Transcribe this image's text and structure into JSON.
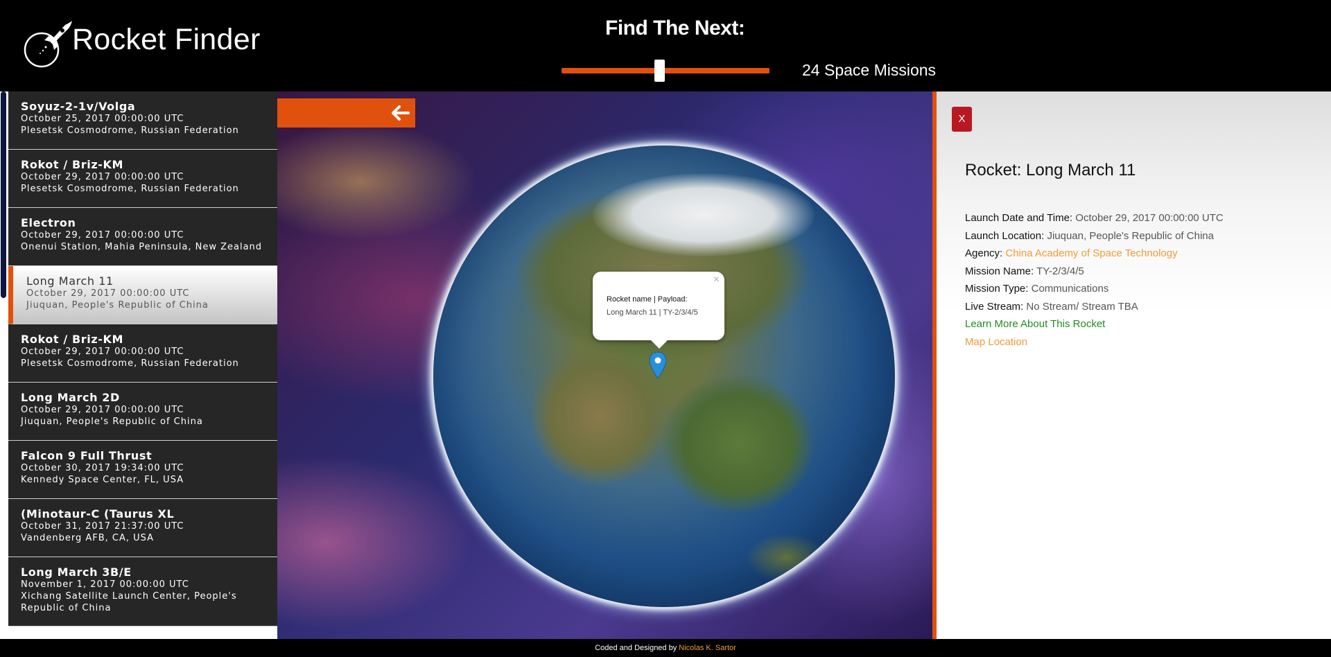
{
  "header": {
    "logo_text": "Rocket Finder",
    "find_title": "Find The Next:",
    "slider_fraction": 0.47,
    "missions_count": "24 Space Missions"
  },
  "launches": [
    {
      "name": "Soyuz-2-1v/Volga",
      "date": "October 25, 2017 00:00:00 UTC",
      "location": "Plesetsk Cosmodrome, Russian Federation"
    },
    {
      "name": "Rokot / Briz-KM",
      "date": "October 29, 2017 00:00:00 UTC",
      "location": "Plesetsk Cosmodrome, Russian Federation"
    },
    {
      "name": "Electron",
      "date": "October 29, 2017 00:00:00 UTC",
      "location": "Onenui Station, Mahia Peninsula, New Zealand"
    },
    {
      "name": "Long March 11",
      "date": "October 29, 2017 00:00:00 UTC",
      "location": "Jiuquan, People's Republic of China"
    },
    {
      "name": "Rokot / Briz-KM",
      "date": "October 29, 2017 00:00:00 UTC",
      "location": "Plesetsk Cosmodrome, Russian Federation"
    },
    {
      "name": "Long March 2D",
      "date": "October 29, 2017 00:00:00 UTC",
      "location": "Jiuquan, People's Republic of China"
    },
    {
      "name": "Falcon 9 Full Thrust",
      "date": "October 30, 2017 19:34:00 UTC",
      "location": "Kennedy Space Center, FL, USA"
    },
    {
      "name": "(Minotaur-C (Taurus XL",
      "date": "October 31, 2017 21:37:00 UTC",
      "location": "Vandenberg AFB, CA, USA"
    },
    {
      "name": "Long March 3B/E",
      "date": "November 1, 2017 00:00:00 UTC",
      "location": "Xichang Satellite Launch Center, People's Republic of China"
    }
  ],
  "map": {
    "popup_label": "Rocket name | Payload:",
    "popup_value": "Long March 11 | TY-2/3/4/5",
    "popup_close": "×"
  },
  "details": {
    "close_label": "X",
    "title": "Rocket: Long March 11",
    "launch_label": "Launch Date and Time:",
    "launch_value": "October 29, 2017 00:00:00 UTC",
    "location_label": "Launch Location:",
    "location_value": "Jiuquan, People's Republic of China",
    "agency_label": "Agency:",
    "agency_value": "China Academy of Space Technology",
    "mission_name_label": "Mission Name:",
    "mission_name_value": "TY-2/3/4/5",
    "mission_type_label": "Mission Type:",
    "mission_type_value": "Communications",
    "stream_label": "Live Stream:",
    "stream_value": "No Stream/ Stream TBA",
    "learn_more": "Learn More About This Rocket",
    "map_location": "Map Location"
  },
  "footer": {
    "text": "Coded and Designed by",
    "author": "Nicolas K. Sartor"
  },
  "colors": {
    "accent": "#e0510d",
    "link_orange": "#f29a3a",
    "link_green": "#1e8e1e",
    "close_red": "#b81921"
  }
}
